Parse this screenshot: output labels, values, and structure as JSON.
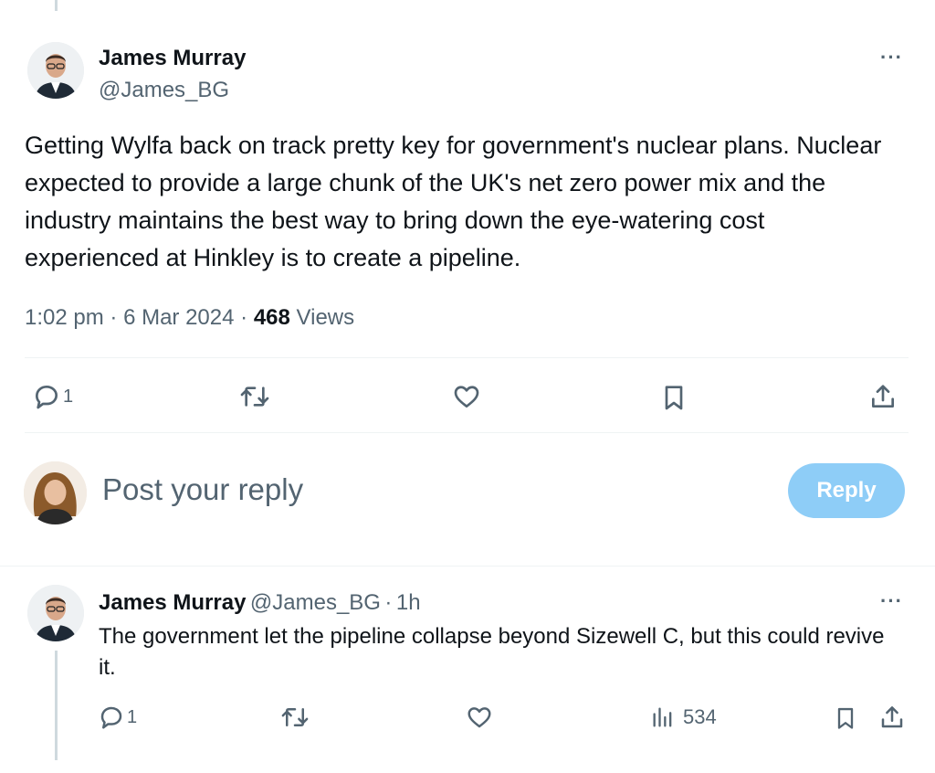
{
  "main_post": {
    "author_name": "James Murray",
    "author_handle": "@James_BG",
    "text": "Getting Wylfa back on track pretty key for government's nuclear plans. Nuclear expected to provide a large chunk of the UK's net zero power mix and the industry maintains the best way to bring down the eye-watering cost experienced at Hinkley is to create a pipeline.",
    "time": "1:02 pm",
    "sep1": "·",
    "date": "6 Mar 2024",
    "sep2": "·",
    "views_count": "468",
    "views_label": "Views",
    "reply_count": "1",
    "more_label": "···"
  },
  "composer": {
    "placeholder": "Post your reply",
    "reply_button": "Reply"
  },
  "reply_post": {
    "author_name": "James Murray",
    "author_handle": "@James_BG",
    "sep": "·",
    "time_ago": "1h",
    "text": "The government let the pipeline collapse beyond Sizewell C, but this could revive it.",
    "reply_count": "1",
    "views_count": "534",
    "more_label": "···"
  },
  "icons": {
    "reply": "speech-bubble-icon",
    "repost": "repost-arrows-icon",
    "like": "heart-icon",
    "bookmark": "bookmark-icon",
    "share": "share-upload-icon",
    "views": "bar-chart-icon"
  },
  "colors": {
    "accent_disabled": "#8ecdf7",
    "secondary_text": "#536471",
    "primary_text": "#0f1419",
    "divider": "#eff3f4"
  }
}
